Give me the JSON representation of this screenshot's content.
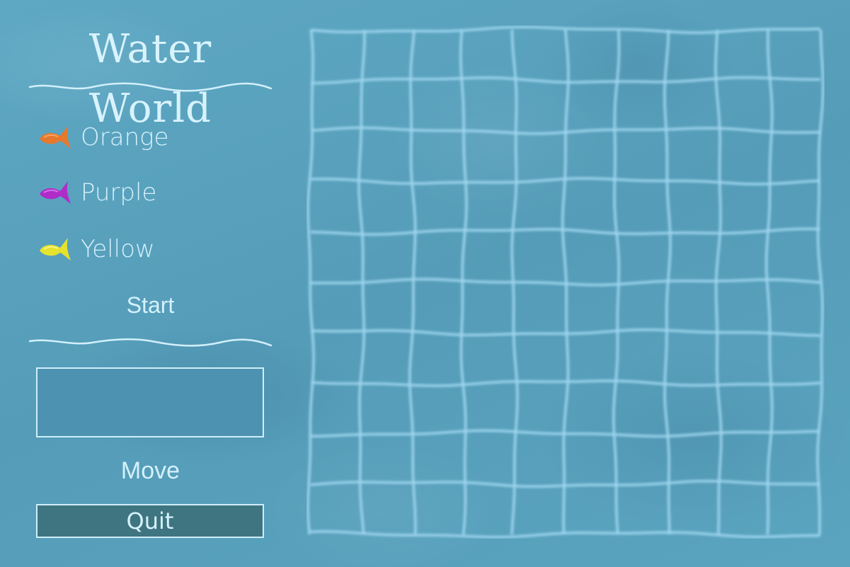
{
  "title": "Water World",
  "players": [
    {
      "label": "Orange",
      "color": "#e8782c",
      "icon": "orange-fish-icon"
    },
    {
      "label": "Purple",
      "color": "#b02cc8",
      "icon": "purple-fish-icon"
    },
    {
      "label": "Yellow",
      "color": "#e6e22e",
      "icon": "yellow-fish-icon"
    }
  ],
  "controls": {
    "start_label": "Start",
    "move_label": "Move",
    "quit_label": "Quit"
  },
  "message": "",
  "board": {
    "columns": 10,
    "rows": 10,
    "line_color": "#9fd6ee"
  },
  "colors": {
    "background": "#5aa3bf",
    "panel_text": "#d4f1fc",
    "quit_fill": "#3f7580"
  }
}
